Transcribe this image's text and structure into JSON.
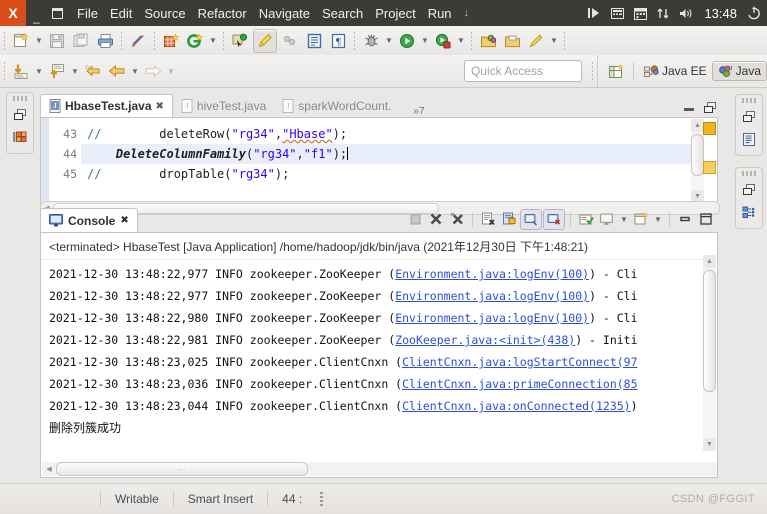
{
  "window": {
    "close_label": "X",
    "minimize_label": "_",
    "maximize_label": "❐"
  },
  "menubar": {
    "items": [
      {
        "label": "File"
      },
      {
        "label": "Edit"
      },
      {
        "label": "Source"
      },
      {
        "label": "Refactor"
      },
      {
        "label": "Navigate"
      },
      {
        "label": "Search"
      },
      {
        "label": "Project"
      },
      {
        "label": "Run"
      }
    ],
    "overflow_label": "↓"
  },
  "tray": {
    "items": [
      {
        "name": "text-entry-icon",
        "glyph": "❙▶"
      },
      {
        "name": "keyboard-icon",
        "glyph": "▤"
      },
      {
        "name": "calendar-icon",
        "glyph": "▦"
      },
      {
        "name": "network-icon",
        "glyph": "↑↓"
      },
      {
        "name": "volume-icon",
        "glyph": "◀))"
      }
    ],
    "clock": "13:48",
    "power_icon": "power-icon"
  },
  "toolbar_main": {
    "groups": [
      {
        "buttons": [
          {
            "name": "new-wizard-button",
            "dropdown": true
          },
          {
            "name": "save-button",
            "dropdown": false
          },
          {
            "name": "save-all-button",
            "dropdown": false
          },
          {
            "name": "print-button",
            "dropdown": false
          }
        ]
      },
      {
        "buttons": [
          {
            "name": "toggle-mark-occurrences-button",
            "dropdown": false
          }
        ]
      },
      {
        "buttons": [
          {
            "name": "new-java-package-button",
            "dropdown": false
          },
          {
            "name": "new-java-class-button",
            "dropdown": true
          }
        ]
      },
      {
        "buttons": [
          {
            "name": "open-type-button",
            "dropdown": false
          },
          {
            "name": "toggle-java-editor-button",
            "dropdown": false,
            "active": true
          },
          {
            "name": "search-button",
            "dropdown": false
          },
          {
            "name": "open-task-button",
            "dropdown": false
          },
          {
            "name": "show-whitespace-button",
            "dropdown": false
          }
        ]
      },
      {
        "buttons": [
          {
            "name": "debug-button",
            "dropdown": true
          },
          {
            "name": "run-button",
            "dropdown": true
          },
          {
            "name": "run-coverage-button",
            "dropdown": true
          }
        ]
      },
      {
        "buttons": [
          {
            "name": "new-folder-button",
            "dropdown": false
          },
          {
            "name": "export-button",
            "dropdown": false
          },
          {
            "name": "annotation-button",
            "dropdown": true
          }
        ]
      }
    ]
  },
  "toolbar_secondary": {
    "buttons": [
      {
        "name": "step-into-button",
        "dropdown": true
      },
      {
        "name": "step-return-button",
        "dropdown": true
      },
      {
        "name": "back-history-button",
        "dropdown": false
      },
      {
        "name": "back-button",
        "dropdown": true
      },
      {
        "name": "forward-button",
        "dropdown": true,
        "disabled": true
      }
    ],
    "quick_access_placeholder": "Quick Access",
    "open-perspective-icon": "open-perspective-icon",
    "perspectives": [
      {
        "name": "perspective-java-ee",
        "label": "Java EE",
        "selected": false
      },
      {
        "name": "perspective-java",
        "label": "Java",
        "selected": true
      }
    ]
  },
  "sidebar_left": {
    "restore_icon": "restore-icon",
    "items": [
      {
        "name": "package-explorer-icon",
        "label": "Package Explorer"
      }
    ]
  },
  "sidebar_right_top": {
    "restore_icon": "restore-icon",
    "items": [
      {
        "name": "outline-icon",
        "label": "Outline"
      }
    ]
  },
  "sidebar_right_bottom": {
    "restore_icon": "restore-icon",
    "items": [
      {
        "name": "task-list-icon",
        "label": "Task List"
      }
    ]
  },
  "editor": {
    "tabs": [
      {
        "name": "tab-hbasetest",
        "label": "HbaseTest.java",
        "selected": true,
        "close_glyph": "✖"
      },
      {
        "name": "tab-hivetest",
        "label": "hiveTest.java",
        "selected": false
      },
      {
        "name": "tab-sparkwordcount",
        "label": "sparkWordCount.",
        "selected": false
      }
    ],
    "tab_overflow_label": "»7",
    "minimize_label": "▬",
    "maximize_label": "❐",
    "lines": [
      {
        "number": "43",
        "highlight": false,
        "segments": [
          {
            "type": "comment",
            "text": "//"
          },
          {
            "type": "plain",
            "text": "        "
          },
          {
            "type": "plain",
            "text": "deleteRow("
          },
          {
            "type": "string",
            "text": "\"rg34\""
          },
          {
            "type": "plain",
            "text": ","
          },
          {
            "type": "string-warn",
            "text": "\"Hbase\""
          },
          {
            "type": "plain",
            "text": ");"
          }
        ]
      },
      {
        "number": "44",
        "highlight": true,
        "segments": [
          {
            "type": "plain",
            "text": "    "
          },
          {
            "type": "italic",
            "text": "DeleteColumnFamily"
          },
          {
            "type": "plain",
            "text": "("
          },
          {
            "type": "string",
            "text": "\"rg34\""
          },
          {
            "type": "plain",
            "text": ","
          },
          {
            "type": "string",
            "text": "\"f1\""
          },
          {
            "type": "plain",
            "text": ");"
          },
          {
            "type": "caret",
            "text": ""
          }
        ]
      },
      {
        "number": "45",
        "highlight": false,
        "segments": [
          {
            "type": "comment",
            "text": "//"
          },
          {
            "type": "plain",
            "text": "        "
          },
          {
            "type": "plain",
            "text": "dropTable("
          },
          {
            "type": "string",
            "text": "\"rg34\""
          },
          {
            "type": "plain",
            "text": ");"
          }
        ]
      }
    ],
    "scroll_up_glyph": "▲",
    "scroll_down_glyph": "▼"
  },
  "console": {
    "tab_label": "Console",
    "tab_close_glyph": "✖",
    "tools": [
      {
        "name": "terminate-button",
        "active": false
      },
      {
        "name": "remove-launch-button",
        "active": false
      },
      {
        "name": "remove-all-terminated-button",
        "active": false
      },
      {
        "name": "clear-console-button",
        "active": false
      },
      {
        "name": "lock-scroll-button",
        "active": false
      },
      {
        "name": "scroll-lock-button",
        "active": true
      },
      {
        "name": "word-wrap-button",
        "active": true
      },
      {
        "name": "show-console-on-output-button",
        "active": false
      },
      {
        "name": "display-selected-console-button",
        "active": false,
        "dropdown": true
      },
      {
        "name": "open-console-button",
        "active": false,
        "dropdown": true
      },
      {
        "name": "minimize-button",
        "active": false
      },
      {
        "name": "maximize-button",
        "active": false
      }
    ],
    "header": "<terminated> HbaseTest [Java Application] /home/hadoop/jdk/bin/java (2021年12月30日 下午1:48:21)",
    "lines": [
      {
        "prefix": "2021-12-30 13:48:22,977 INFO   zookeeper.ZooKeeper (",
        "link": "Environment.java:logEnv(100)",
        "suffix": ") - Cli"
      },
      {
        "prefix": "2021-12-30 13:48:22,977 INFO   zookeeper.ZooKeeper (",
        "link": "Environment.java:logEnv(100)",
        "suffix": ") - Cli"
      },
      {
        "prefix": "2021-12-30 13:48:22,980 INFO   zookeeper.ZooKeeper (",
        "link": "Environment.java:logEnv(100)",
        "suffix": ") - Cli"
      },
      {
        "prefix": "2021-12-30 13:48:22,981 INFO   zookeeper.ZooKeeper (",
        "link": "ZooKeeper.java:<init>(438)",
        "suffix": ") - Initi"
      },
      {
        "prefix": "2021-12-30 13:48:23,025 INFO   zookeeper.ClientCnxn (",
        "link": "ClientCnxn.java:logStartConnect(97",
        "suffix": ""
      },
      {
        "prefix": "2021-12-30 13:48:23,036 INFO   zookeeper.ClientCnxn (",
        "link": "ClientCnxn.java:primeConnection(85",
        "suffix": ""
      },
      {
        "prefix": "2021-12-30 13:48:23,044 INFO   zookeeper.ClientCnxn (",
        "link": "ClientCnxn.java:onConnected(1235)",
        "suffix": ")"
      },
      {
        "prefix": "删除列簇成功",
        "link": "",
        "suffix": ""
      }
    ]
  },
  "statusbar": {
    "writable": "Writable",
    "insert_mode": "Smart Insert",
    "position": "44 :",
    "watermark": "CSDN @FGGIT"
  },
  "colors": {
    "titlebar_bg": "#3c3b37",
    "close_btn": "#d94d1a",
    "link": "#2c4fd6",
    "string": "#2a00ff",
    "comment": "#3f7f5f",
    "selection": "#e8eefa"
  }
}
